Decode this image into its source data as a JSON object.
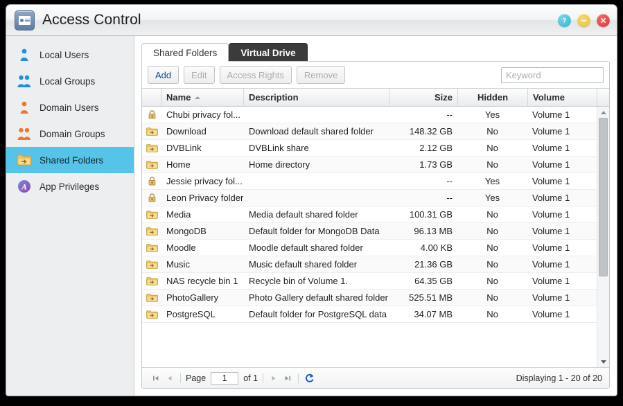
{
  "window": {
    "title": "Access Control",
    "app_icon": "id-card-icon",
    "buttons": {
      "help": "help-button",
      "minimize": "minimize-button",
      "close": "close-button"
    }
  },
  "sidebar": {
    "items": [
      {
        "label": "Local Users",
        "icon": "user-blue-icon",
        "selected": false
      },
      {
        "label": "Local Groups",
        "icon": "users-blue-icon",
        "selected": false
      },
      {
        "label": "Domain Users",
        "icon": "user-orange-icon",
        "selected": false
      },
      {
        "label": "Domain Groups",
        "icon": "users-orange-icon",
        "selected": false
      },
      {
        "label": "Shared Folders",
        "icon": "shared-folder-icon",
        "selected": true
      },
      {
        "label": "App Privileges",
        "icon": "app-privileges-icon",
        "selected": false
      }
    ]
  },
  "tabs": [
    {
      "label": "Shared Folders",
      "state": "active"
    },
    {
      "label": "Virtual Drive",
      "state": "hovered"
    }
  ],
  "toolbar": {
    "buttons": [
      {
        "label": "Add",
        "enabled": true
      },
      {
        "label": "Edit",
        "enabled": false
      },
      {
        "label": "Access Rights",
        "enabled": false
      },
      {
        "label": "Remove",
        "enabled": false
      }
    ],
    "search": {
      "value": "",
      "placeholder": "Keyword"
    }
  },
  "table": {
    "columns": [
      "Name",
      "Description",
      "Size",
      "Hidden",
      "Volume"
    ],
    "sort": {
      "column": "Name",
      "direction": "asc"
    },
    "rows": [
      {
        "icon": "lock-icon",
        "name": "Chubi privacy fol...",
        "description": "",
        "size": "--",
        "hidden": "Yes",
        "volume": "Volume 1"
      },
      {
        "icon": "folder-icon",
        "name": "Download",
        "description": "Download default shared folder",
        "size": "148.32 GB",
        "hidden": "No",
        "volume": "Volume 1"
      },
      {
        "icon": "folder-icon",
        "name": "DVBLink",
        "description": "DVBLink share",
        "size": "2.12 GB",
        "hidden": "No",
        "volume": "Volume 1"
      },
      {
        "icon": "folder-icon",
        "name": "Home",
        "description": "Home directory",
        "size": "1.73 GB",
        "hidden": "No",
        "volume": "Volume 1"
      },
      {
        "icon": "lock-icon",
        "name": "Jessie privacy fol...",
        "description": "",
        "size": "--",
        "hidden": "Yes",
        "volume": "Volume 1"
      },
      {
        "icon": "lock-icon",
        "name": "Leon Privacy folder",
        "description": "",
        "size": "--",
        "hidden": "Yes",
        "volume": "Volume 1"
      },
      {
        "icon": "folder-icon",
        "name": "Media",
        "description": "Media default shared folder",
        "size": "100.31 GB",
        "hidden": "No",
        "volume": "Volume 1"
      },
      {
        "icon": "folder-icon",
        "name": "MongoDB",
        "description": "Default folder for MongoDB Data",
        "size": "96.13 MB",
        "hidden": "No",
        "volume": "Volume 1"
      },
      {
        "icon": "folder-icon",
        "name": "Moodle",
        "description": "Moodle default shared folder",
        "size": "4.00 KB",
        "hidden": "No",
        "volume": "Volume 1"
      },
      {
        "icon": "folder-icon",
        "name": "Music",
        "description": "Music default shared folder",
        "size": "21.36 GB",
        "hidden": "No",
        "volume": "Volume 1"
      },
      {
        "icon": "folder-icon",
        "name": "NAS recycle bin 1",
        "description": "Recycle bin of Volume 1.",
        "size": "64.35 GB",
        "hidden": "No",
        "volume": "Volume 1"
      },
      {
        "icon": "folder-icon",
        "name": "PhotoGallery",
        "description": "Photo Gallery default shared folder",
        "size": "525.51 MB",
        "hidden": "No",
        "volume": "Volume 1"
      },
      {
        "icon": "folder-icon",
        "name": "PostgreSQL",
        "description": "Default folder for PostgreSQL data",
        "size": "34.07 MB",
        "hidden": "No",
        "volume": "Volume 1"
      }
    ]
  },
  "pager": {
    "first": "first-page-button",
    "prev": "previous-page-button",
    "page_label": "Page",
    "page_value": "1",
    "of_label": "of 1",
    "next": "next-page-button",
    "last": "last-page-button",
    "refresh": "refresh-button",
    "displaying": "Displaying 1 - 20 of 20"
  },
  "colors": {
    "selection": "#56c4e8",
    "tab_hover": "#3b3b3b",
    "link": "#15489c",
    "folder": "#e8b33c",
    "accent_refresh": "#1d5fc4"
  }
}
